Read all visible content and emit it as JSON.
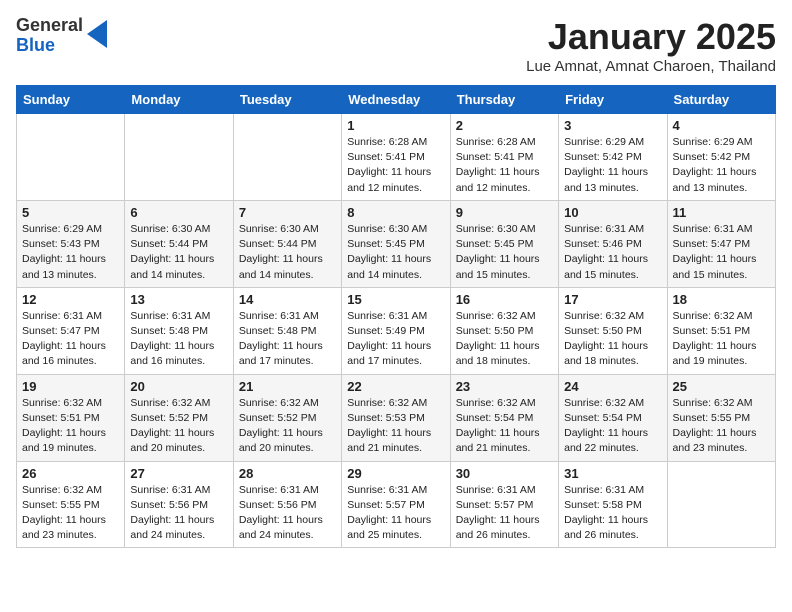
{
  "header": {
    "logo_general": "General",
    "logo_blue": "Blue",
    "month_title": "January 2025",
    "location": "Lue Amnat, Amnat Charoen, Thailand"
  },
  "days_of_week": [
    "Sunday",
    "Monday",
    "Tuesday",
    "Wednesday",
    "Thursday",
    "Friday",
    "Saturday"
  ],
  "weeks": [
    [
      {
        "day": "",
        "info": ""
      },
      {
        "day": "",
        "info": ""
      },
      {
        "day": "",
        "info": ""
      },
      {
        "day": "1",
        "info": "Sunrise: 6:28 AM\nSunset: 5:41 PM\nDaylight: 11 hours\nand 12 minutes."
      },
      {
        "day": "2",
        "info": "Sunrise: 6:28 AM\nSunset: 5:41 PM\nDaylight: 11 hours\nand 12 minutes."
      },
      {
        "day": "3",
        "info": "Sunrise: 6:29 AM\nSunset: 5:42 PM\nDaylight: 11 hours\nand 13 minutes."
      },
      {
        "day": "4",
        "info": "Sunrise: 6:29 AM\nSunset: 5:42 PM\nDaylight: 11 hours\nand 13 minutes."
      }
    ],
    [
      {
        "day": "5",
        "info": "Sunrise: 6:29 AM\nSunset: 5:43 PM\nDaylight: 11 hours\nand 13 minutes."
      },
      {
        "day": "6",
        "info": "Sunrise: 6:30 AM\nSunset: 5:44 PM\nDaylight: 11 hours\nand 14 minutes."
      },
      {
        "day": "7",
        "info": "Sunrise: 6:30 AM\nSunset: 5:44 PM\nDaylight: 11 hours\nand 14 minutes."
      },
      {
        "day": "8",
        "info": "Sunrise: 6:30 AM\nSunset: 5:45 PM\nDaylight: 11 hours\nand 14 minutes."
      },
      {
        "day": "9",
        "info": "Sunrise: 6:30 AM\nSunset: 5:45 PM\nDaylight: 11 hours\nand 15 minutes."
      },
      {
        "day": "10",
        "info": "Sunrise: 6:31 AM\nSunset: 5:46 PM\nDaylight: 11 hours\nand 15 minutes."
      },
      {
        "day": "11",
        "info": "Sunrise: 6:31 AM\nSunset: 5:47 PM\nDaylight: 11 hours\nand 15 minutes."
      }
    ],
    [
      {
        "day": "12",
        "info": "Sunrise: 6:31 AM\nSunset: 5:47 PM\nDaylight: 11 hours\nand 16 minutes."
      },
      {
        "day": "13",
        "info": "Sunrise: 6:31 AM\nSunset: 5:48 PM\nDaylight: 11 hours\nand 16 minutes."
      },
      {
        "day": "14",
        "info": "Sunrise: 6:31 AM\nSunset: 5:48 PM\nDaylight: 11 hours\nand 17 minutes."
      },
      {
        "day": "15",
        "info": "Sunrise: 6:31 AM\nSunset: 5:49 PM\nDaylight: 11 hours\nand 17 minutes."
      },
      {
        "day": "16",
        "info": "Sunrise: 6:32 AM\nSunset: 5:50 PM\nDaylight: 11 hours\nand 18 minutes."
      },
      {
        "day": "17",
        "info": "Sunrise: 6:32 AM\nSunset: 5:50 PM\nDaylight: 11 hours\nand 18 minutes."
      },
      {
        "day": "18",
        "info": "Sunrise: 6:32 AM\nSunset: 5:51 PM\nDaylight: 11 hours\nand 19 minutes."
      }
    ],
    [
      {
        "day": "19",
        "info": "Sunrise: 6:32 AM\nSunset: 5:51 PM\nDaylight: 11 hours\nand 19 minutes."
      },
      {
        "day": "20",
        "info": "Sunrise: 6:32 AM\nSunset: 5:52 PM\nDaylight: 11 hours\nand 20 minutes."
      },
      {
        "day": "21",
        "info": "Sunrise: 6:32 AM\nSunset: 5:52 PM\nDaylight: 11 hours\nand 20 minutes."
      },
      {
        "day": "22",
        "info": "Sunrise: 6:32 AM\nSunset: 5:53 PM\nDaylight: 11 hours\nand 21 minutes."
      },
      {
        "day": "23",
        "info": "Sunrise: 6:32 AM\nSunset: 5:54 PM\nDaylight: 11 hours\nand 21 minutes."
      },
      {
        "day": "24",
        "info": "Sunrise: 6:32 AM\nSunset: 5:54 PM\nDaylight: 11 hours\nand 22 minutes."
      },
      {
        "day": "25",
        "info": "Sunrise: 6:32 AM\nSunset: 5:55 PM\nDaylight: 11 hours\nand 23 minutes."
      }
    ],
    [
      {
        "day": "26",
        "info": "Sunrise: 6:32 AM\nSunset: 5:55 PM\nDaylight: 11 hours\nand 23 minutes."
      },
      {
        "day": "27",
        "info": "Sunrise: 6:31 AM\nSunset: 5:56 PM\nDaylight: 11 hours\nand 24 minutes."
      },
      {
        "day": "28",
        "info": "Sunrise: 6:31 AM\nSunset: 5:56 PM\nDaylight: 11 hours\nand 24 minutes."
      },
      {
        "day": "29",
        "info": "Sunrise: 6:31 AM\nSunset: 5:57 PM\nDaylight: 11 hours\nand 25 minutes."
      },
      {
        "day": "30",
        "info": "Sunrise: 6:31 AM\nSunset: 5:57 PM\nDaylight: 11 hours\nand 26 minutes."
      },
      {
        "day": "31",
        "info": "Sunrise: 6:31 AM\nSunset: 5:58 PM\nDaylight: 11 hours\nand 26 minutes."
      },
      {
        "day": "",
        "info": ""
      }
    ]
  ]
}
